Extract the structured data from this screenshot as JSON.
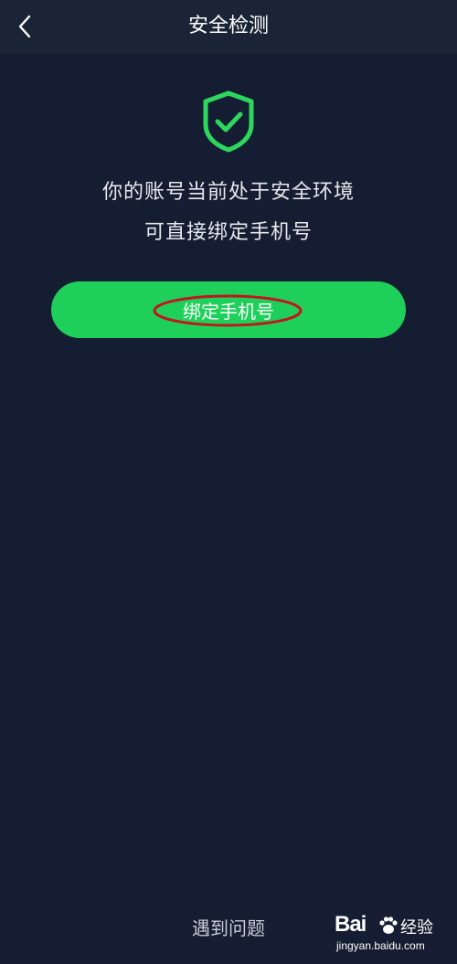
{
  "header": {
    "title": "安全检测",
    "back_icon": "chevron-left-icon"
  },
  "status": {
    "icon": "shield-check-icon",
    "line1": "你的账号当前处于安全环境",
    "line2": "可直接绑定手机号"
  },
  "actions": {
    "bind_phone_label": "绑定手机号",
    "help_label": "遇到问题"
  },
  "watermark": {
    "brand": "Bai",
    "brand_cn": "经验",
    "url": "jingyan.baidu.com"
  },
  "colors": {
    "background": "#141d31",
    "header": "#1b2436",
    "accent_green": "#1ed05a",
    "annotation_red": "#c0161e"
  }
}
